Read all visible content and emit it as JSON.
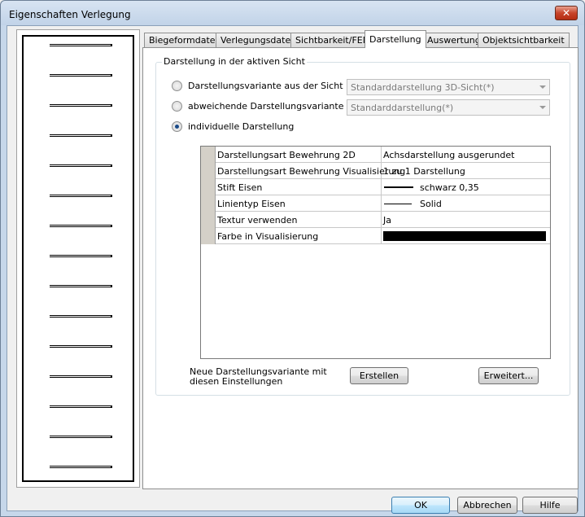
{
  "window": {
    "title": "Eigenschaften Verlegung",
    "close_glyph": "✕"
  },
  "preview": {
    "line_count": 15
  },
  "tabs": [
    {
      "label": "Biegeformdaten",
      "active": false
    },
    {
      "label": "Verlegungsdaten",
      "active": false
    },
    {
      "label": "Sichtbarkeit/FEM",
      "active": false
    },
    {
      "label": "Darstellung",
      "active": true
    },
    {
      "label": "Auswertung",
      "active": false
    },
    {
      "label": "Objektsichtbarkeit",
      "active": false
    }
  ],
  "group": {
    "title": "Darstellung in der aktiven Sicht",
    "options": [
      {
        "label": "Darstellungsvariante aus der Sicht",
        "checked": false,
        "combo": "Standarddarstellung 3D-Sicht(*)"
      },
      {
        "label": "abweichende Darstellungsvariante",
        "checked": false,
        "combo": "Standarddarstellung(*)"
      },
      {
        "label": "individuelle Darstellung",
        "checked": true
      }
    ]
  },
  "properties": [
    {
      "name": "Darstellungsart Bewehrung 2D",
      "value": "Achsdarstellung ausgerundet"
    },
    {
      "name": "Darstellungsart Bewehrung Visualisierung",
      "value": "1 zu 1 Darstellung"
    },
    {
      "name": "Stift Eisen",
      "value": "schwarz 0,35"
    },
    {
      "name": "Linientyp Eisen",
      "value": "Solid"
    },
    {
      "name": "Textur verwenden",
      "value": "Ja"
    },
    {
      "name": "Farbe in Visualisierung",
      "value": "",
      "color": "#000000"
    }
  ],
  "footer": {
    "label": "Neue Darstellungsvariante mit diesen Einstellungen",
    "create_button": "Erstellen",
    "advanced_button": "Erweitert..."
  },
  "dialog_buttons": {
    "ok": "OK",
    "cancel": "Abbrechen",
    "help": "Hilfe"
  }
}
